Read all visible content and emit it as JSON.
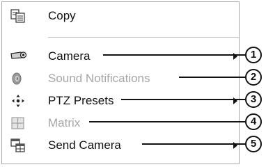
{
  "menu": {
    "copy": {
      "label": "Copy",
      "icon": "copy-icon"
    },
    "camera": {
      "label": "Camera",
      "icon": "camera-icon",
      "submenu": true,
      "callout": "1"
    },
    "sound": {
      "label": "Sound Notifications",
      "icon": "speaker-icon",
      "disabled": true,
      "callout": "2"
    },
    "ptz": {
      "label": "PTZ Presets",
      "icon": "ptz-arrows-icon",
      "submenu": true,
      "callout": "3"
    },
    "matrix": {
      "label": "Matrix",
      "icon": "matrix-grid-icon",
      "disabled": true,
      "callout": "4"
    },
    "send": {
      "label": "Send Camera",
      "icon": "send-camera-icon",
      "submenu": true,
      "callout": "5"
    }
  },
  "colors": {
    "text": "#111111",
    "disabled_text": "#a6a6a6",
    "border": "#a8a8a8"
  }
}
